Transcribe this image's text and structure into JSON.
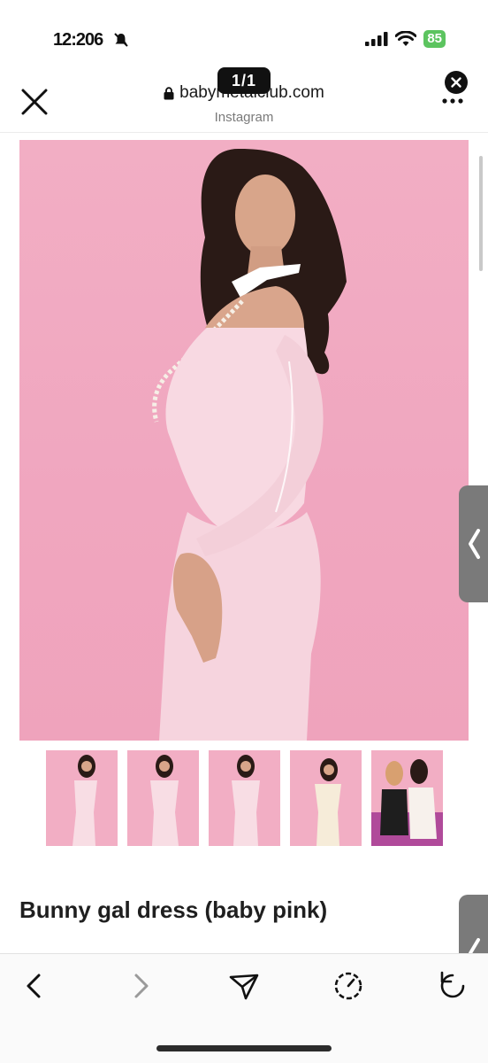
{
  "status_bar": {
    "time": "12:206",
    "battery_level": "85",
    "icons": [
      "bell-slash-icon",
      "cellular-signal-icon",
      "wifi-icon",
      "battery-icon"
    ]
  },
  "browser": {
    "domain": "babymetalclub.com",
    "source_label": "Instagram",
    "page_indicator": "1/1",
    "icons": [
      "close-icon",
      "lock-icon",
      "more-icon",
      "dismiss-icon"
    ]
  },
  "product": {
    "title": "Bunny gal dress (baby pink)",
    "thumbnail_count": 5,
    "active_image": 1
  },
  "toolbar": {
    "icons": [
      "back-icon",
      "forward-icon",
      "share-icon",
      "history-icon",
      "refresh-icon"
    ]
  },
  "colors": {
    "photo_background": "#f2aec4",
    "dress": "#f8d9e2",
    "side_tab": "#7a7a7a",
    "battery": "#5cc45f"
  }
}
